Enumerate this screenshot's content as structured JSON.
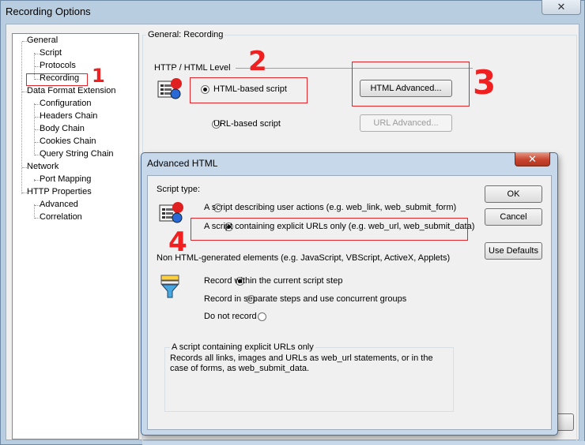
{
  "window": {
    "title": "Recording Options",
    "close_glyph": "✕"
  },
  "tree": {
    "items": [
      {
        "label": "General",
        "level": 0
      },
      {
        "label": "Script",
        "level": 1
      },
      {
        "label": "Protocols",
        "level": 1
      },
      {
        "label": "Recording",
        "level": 1
      },
      {
        "label": "Data Format Extension",
        "level": 0
      },
      {
        "label": "Configuration",
        "level": 1
      },
      {
        "label": "Headers Chain",
        "level": 1
      },
      {
        "label": "Body Chain",
        "level": 1
      },
      {
        "label": "Cookies Chain",
        "level": 1
      },
      {
        "label": "Query String Chain",
        "level": 1
      },
      {
        "label": "Network",
        "level": 0
      },
      {
        "label": "Port Mapping",
        "level": 1
      },
      {
        "label": "HTTP Properties",
        "level": 0
      },
      {
        "label": "Advanced",
        "level": 1
      },
      {
        "label": "Correlation",
        "level": 1
      }
    ]
  },
  "general_recording": {
    "group_label": "General: Recording",
    "level_label": "HTTP / HTML Level",
    "html_based_label": "HTML-based script",
    "url_based_label": "URL-based script",
    "html_advanced_button": "HTML Advanced...",
    "url_advanced_button": "URL Advanced..."
  },
  "annotations": {
    "one": "1",
    "two": "2",
    "three": "3",
    "four": "4",
    "color": "#e0262a"
  },
  "dialog": {
    "title": "Advanced HTML",
    "close_glyph": "✕",
    "script_type_label": "Script type:",
    "option_user_actions": "A script describing user actions (e.g. web_link, web_submit_form)",
    "option_explicit_urls": "A script containing explicit URLs only (e.g. web_url, web_submit_data)",
    "non_html_label": "Non HTML-generated elements (e.g. JavaScript, VBScript, ActiveX, Applets)",
    "record_within": "Record within the current script step",
    "record_separate": "Record in separate steps and use concurrent groups",
    "do_not_record": "Do not record",
    "desc_title": "A script containing explicit URLs only",
    "desc_text": "Records all links, images and URLs as web_url statements, or in the case of forms, as web_submit_data.",
    "ok_button": "OK",
    "cancel_button": "Cancel",
    "use_defaults_button": "Use Defaults"
  }
}
